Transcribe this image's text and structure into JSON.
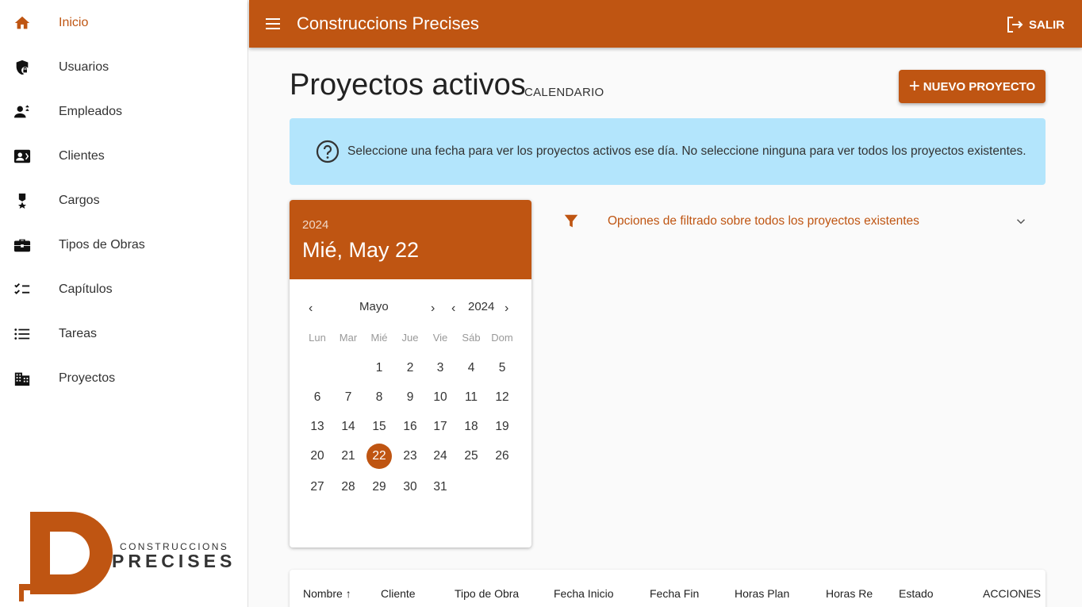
{
  "app": {
    "title": "Construccions Precises",
    "logout_label": "SALIR"
  },
  "sidebar": {
    "items": [
      {
        "label": "Inicio",
        "icon": "home-icon"
      },
      {
        "label": "Usuarios",
        "icon": "shield-lock-icon"
      },
      {
        "label": "Empleados",
        "icon": "employees-icon"
      },
      {
        "label": "Clientes",
        "icon": "contact-card-icon"
      },
      {
        "label": "Cargos",
        "icon": "medal-icon"
      },
      {
        "label": "Tipos de Obras",
        "icon": "toolbox-icon"
      },
      {
        "label": "Capítulos",
        "icon": "checklist-icon"
      },
      {
        "label": "Tareas",
        "icon": "list-icon"
      },
      {
        "label": "Proyectos",
        "icon": "building-icon"
      }
    ],
    "logo_top": "CONSTRUCCIONS",
    "logo_bottom": "PRECISES"
  },
  "page": {
    "title": "Proyectos activos",
    "subtitle": "CALENDARIO",
    "new_button": "NUEVO PROYECTO",
    "info": "Seleccione una fecha para ver los proyectos activos ese día. No seleccione ninguna para ver todos los proyectos existentes."
  },
  "calendar": {
    "year": "2024",
    "selected_label": "Mié, May 22",
    "month_nav": "Mayo",
    "year_nav": "2024",
    "weekdays": [
      "Lun",
      "Mar",
      "Mié",
      "Jue",
      "Vie",
      "Sáb",
      "Dom"
    ],
    "weeks": [
      [
        "",
        "",
        "1",
        "2",
        "3",
        "4",
        "5"
      ],
      [
        "6",
        "7",
        "8",
        "9",
        "10",
        "11",
        "12"
      ],
      [
        "13",
        "14",
        "15",
        "16",
        "17",
        "18",
        "19"
      ],
      [
        "20",
        "21",
        "22",
        "23",
        "24",
        "25",
        "26"
      ],
      [
        "27",
        "28",
        "29",
        "30",
        "31",
        "",
        ""
      ]
    ],
    "selected_day": "22"
  },
  "filter": {
    "label": "Opciones de filtrado sobre todos los proyectos existentes"
  },
  "table": {
    "columns": [
      "Nombre",
      "Cliente",
      "Tipo de Obra",
      "Fecha Inicio",
      "Fecha Fin",
      "Horas Plan",
      "Horas Re",
      "Estado",
      "ACCIONES"
    ]
  },
  "colors": {
    "accent": "#bf5512",
    "info_bg": "#b3e5fc"
  }
}
